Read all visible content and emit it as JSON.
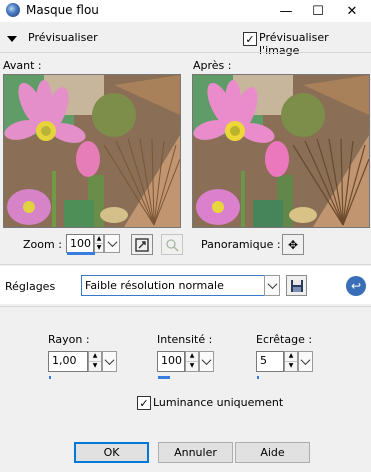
{
  "window": {
    "title": "Masque flou",
    "minimize": "—",
    "maximize": "☐",
    "close": "✕"
  },
  "preview_bar": {
    "label": "Prévisualiser",
    "checkbox_label": "Prévisualiser l'image",
    "checkbox_checked": true
  },
  "previews": {
    "before_label": "Avant :",
    "after_label": "Après :"
  },
  "zoom": {
    "label": "Zoom :",
    "value": "100",
    "pan_label": "Panoramique :"
  },
  "presets": {
    "label": "Réglages",
    "selected": "Faible résolution normale"
  },
  "params": {
    "radius": {
      "label": "Rayon :",
      "value": "1,00"
    },
    "intensity": {
      "label": "Intensité :",
      "value": "100"
    },
    "clipping": {
      "label": "Ecrêtage :",
      "value": "5"
    },
    "luminance": {
      "label": "Luminance uniquement",
      "checked": true
    }
  },
  "buttons": {
    "ok": "OK",
    "cancel": "Annuler",
    "help": "Aide"
  },
  "colors": {
    "accent": "#0078d7",
    "level_bar": "#3a7de0",
    "reset_icon": "#3a6fb8"
  },
  "icons": {
    "collapse": "triangle-down-icon",
    "fit": "fit-window-icon",
    "zoom_tool": "zoom-tool-icon",
    "pan": "pan-move-icon",
    "save": "save-disk-icon",
    "reset": "reset-icon"
  }
}
